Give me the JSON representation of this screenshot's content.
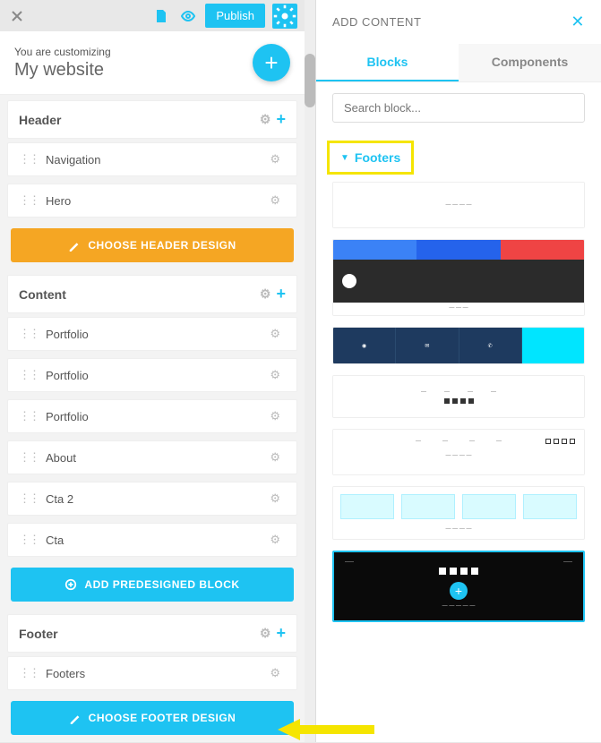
{
  "topbar": {
    "publish": "Publish"
  },
  "customizer": {
    "sub": "You are customizing",
    "title": "My website"
  },
  "sections": {
    "header": {
      "title": "Header",
      "blocks": [
        "Navigation",
        "Hero"
      ],
      "cta": "CHOOSE HEADER DESIGN"
    },
    "content": {
      "title": "Content",
      "blocks": [
        "Portfolio",
        "Portfolio",
        "Portfolio",
        "About",
        "Cta 2",
        "Cta"
      ],
      "cta": "ADD PREDESIGNED BLOCK"
    },
    "footer": {
      "title": "Footer",
      "blocks": [
        "Footers"
      ],
      "cta": "CHOOSE FOOTER DESIGN"
    }
  },
  "panel": {
    "heading": "ADD CONTENT",
    "tabs": {
      "blocks": "Blocks",
      "components": "Components"
    },
    "search_placeholder": "Search block...",
    "category": "Footers"
  }
}
